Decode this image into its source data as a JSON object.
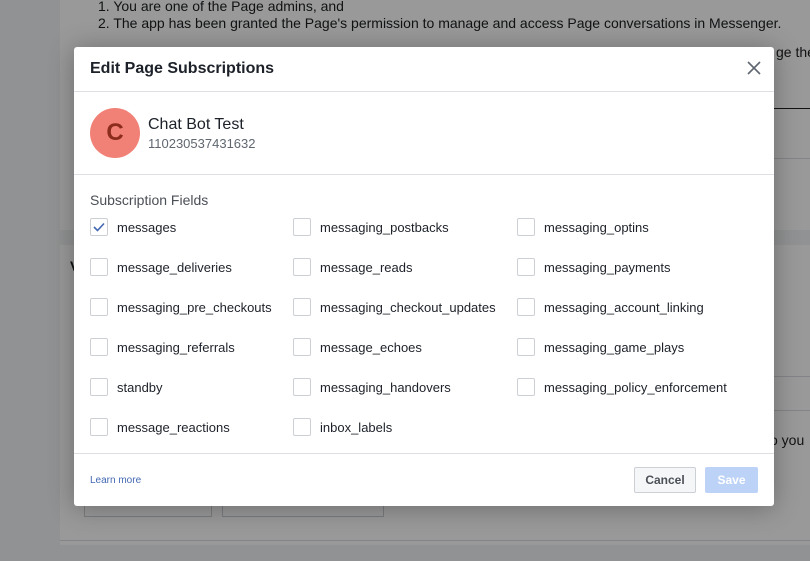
{
  "background": {
    "list_items": [
      "1. You are one of the Page admins, and",
      "2. The app has been granted the Page's permission to manage and access Page conversations in Messenger."
    ],
    "line3_partial": "ge the",
    "right_partial": "o you",
    "w_partial": "V"
  },
  "modal": {
    "title": "Edit Page Subscriptions",
    "close_icon": "close-icon",
    "page": {
      "avatar_letter": "C",
      "avatar_color": "#f18076",
      "name": "Chat Bot Test",
      "id": "110230537431632"
    },
    "fields_title": "Subscription Fields",
    "fields": [
      {
        "label": "messages",
        "checked": true
      },
      {
        "label": "messaging_postbacks",
        "checked": false
      },
      {
        "label": "messaging_optins",
        "checked": false
      },
      {
        "label": "message_deliveries",
        "checked": false
      },
      {
        "label": "message_reads",
        "checked": false
      },
      {
        "label": "messaging_payments",
        "checked": false
      },
      {
        "label": "messaging_pre_checkouts",
        "checked": false
      },
      {
        "label": "messaging_checkout_updates",
        "checked": false
      },
      {
        "label": "messaging_account_linking",
        "checked": false
      },
      {
        "label": "messaging_referrals",
        "checked": false
      },
      {
        "label": "message_echoes",
        "checked": false
      },
      {
        "label": "messaging_game_plays",
        "checked": false
      },
      {
        "label": "standby",
        "checked": false
      },
      {
        "label": "messaging_handovers",
        "checked": false
      },
      {
        "label": "messaging_policy_enforcement",
        "checked": false
      },
      {
        "label": "message_reactions",
        "checked": false
      },
      {
        "label": "inbox_labels",
        "checked": false
      }
    ],
    "footer": {
      "learn_more": "Learn more",
      "cancel_label": "Cancel",
      "save_label": "Save"
    }
  }
}
